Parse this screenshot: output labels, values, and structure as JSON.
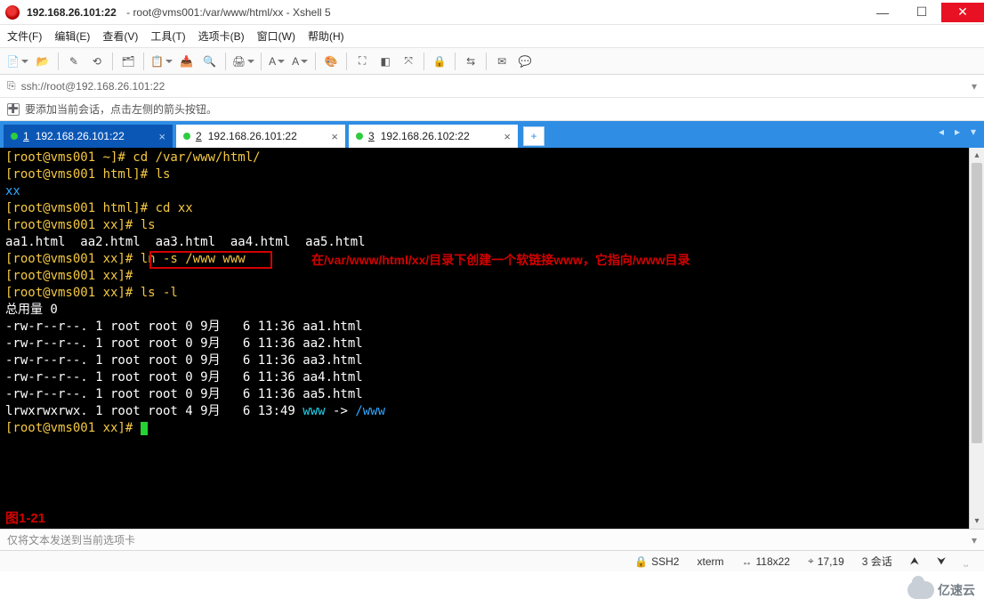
{
  "window": {
    "title_bold": "192.168.26.101:22",
    "title_rest": "root@vms001:/var/www/html/xx - Xshell 5"
  },
  "menu": [
    "文件(F)",
    "编辑(E)",
    "查看(V)",
    "工具(T)",
    "选项卡(B)",
    "窗口(W)",
    "帮助(H)"
  ],
  "toolbar_icons": [
    "new-session-icon",
    "open-icon",
    "sep",
    "reconnect-icon",
    "disconnect-icon",
    "sep",
    "properties-icon",
    "sep",
    "copy-icon",
    "paste-icon",
    "find-icon",
    "sep",
    "print-icon",
    "sep",
    "font-style-icon",
    "font-icon",
    "sep",
    "color-scheme-icon",
    "sep",
    "fullscreen-icon",
    "transparency-icon",
    "always-top-icon",
    "sep",
    "lock-icon",
    "sep",
    "xftp-icon",
    "sep",
    "compose-icon",
    "broadcast-icon"
  ],
  "addressbar": {
    "url": "ssh://root@192.168.26.101:22"
  },
  "hint": "要添加当前会话，点击左侧的箭头按钮。",
  "tabs": [
    {
      "index": "1",
      "label": "192.168.26.101:22",
      "active": true
    },
    {
      "index": "2",
      "label": "192.168.26.101:22",
      "active": false
    },
    {
      "index": "3",
      "label": "192.168.26.102:22",
      "active": false
    }
  ],
  "terminal": {
    "lines": [
      {
        "t": "[root@vms001 ~]# cd /var/www/html/",
        "c": "yellow"
      },
      {
        "t": "[root@vms001 html]# ls",
        "c": "yellow"
      },
      {
        "t": "xx",
        "c": "blue"
      },
      {
        "t": "[root@vms001 html]# cd xx",
        "c": "yellow"
      },
      {
        "t": "[root@vms001 xx]# ls",
        "c": "yellow"
      },
      {
        "t": "aa1.html  aa2.html  aa3.html  aa4.html  aa5.html",
        "c": "white"
      },
      {
        "prompt": "[root@vms001 xx]# ",
        "boxed_cmd": "ln -s /www www"
      },
      {
        "t": "[root@vms001 xx]#",
        "c": "yellow"
      },
      {
        "t": "[root@vms001 xx]# ls -l",
        "c": "yellow"
      },
      {
        "t": "总用量 0",
        "c": "white"
      },
      {
        "t": "-rw-r--r--. 1 root root 0 9月   6 11:36 aa1.html",
        "c": "white"
      },
      {
        "t": "-rw-r--r--. 1 root root 0 9月   6 11:36 aa2.html",
        "c": "white"
      },
      {
        "t": "-rw-r--r--. 1 root root 0 9月   6 11:36 aa3.html",
        "c": "white"
      },
      {
        "t": "-rw-r--r--. 1 root root 0 9月   6 11:36 aa4.html",
        "c": "white"
      },
      {
        "t": "-rw-r--r--. 1 root root 0 9月   6 11:36 aa5.html",
        "c": "white"
      },
      {
        "ls_l_link": {
          "perm": "lrwxrwxrwx. 1 root root 4 9月   6 13:49 ",
          "name": "www",
          "arrow": " -> ",
          "target": "/www"
        }
      },
      {
        "prompt_cursor": "[root@vms001 xx]# "
      }
    ],
    "annotation": "在/var/www/html/xx/目录下创建一个软链接www，它指向/www目录",
    "fig_label": "图1-21"
  },
  "compose_placeholder": "仅将文本发送到当前选项卡",
  "status": {
    "proto": "SSH2",
    "term": "xterm",
    "size": "118x22",
    "cursor": "17,19",
    "sessions": "3 会话"
  },
  "watermark": "亿速云"
}
